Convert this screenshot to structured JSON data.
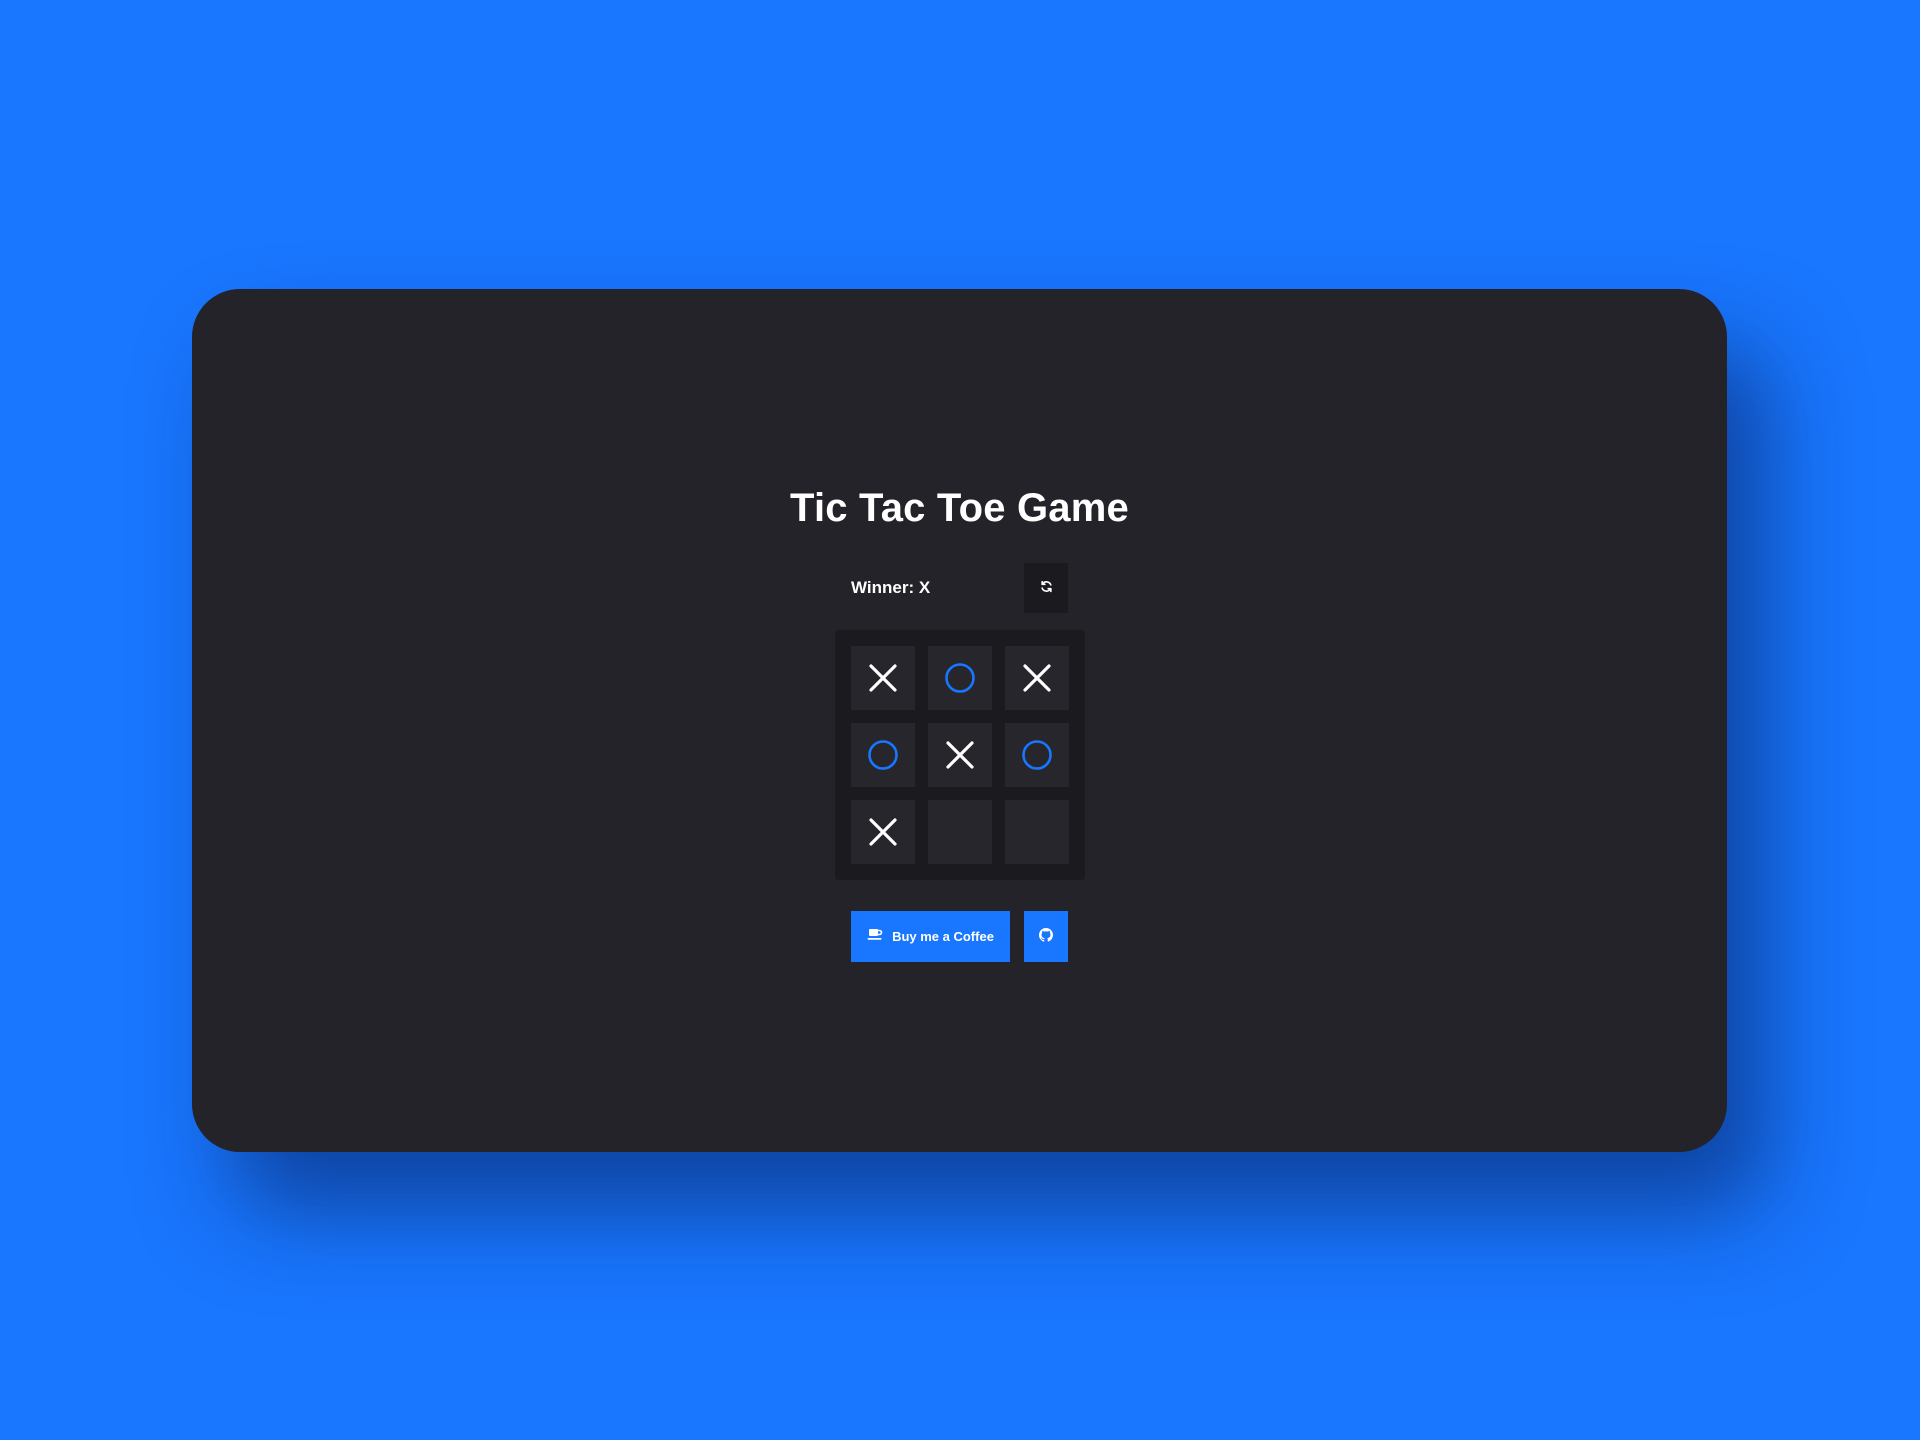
{
  "page": {
    "background_color": "#1976fe",
    "card_color": "#232329"
  },
  "game": {
    "title": "Tic Tac Toe Game",
    "status_text": "Winner: X",
    "reset_icon": "refresh-icon",
    "board": [
      "X",
      "O",
      "X",
      "O",
      "X",
      "O",
      "X",
      "",
      ""
    ],
    "x_color": "#ffffff",
    "o_color": "#1976fe"
  },
  "footer": {
    "coffee_label": "Buy me a Coffee",
    "coffee_icon": "coffee-cup-icon",
    "github_icon": "github-icon",
    "button_color": "#1976fe"
  }
}
